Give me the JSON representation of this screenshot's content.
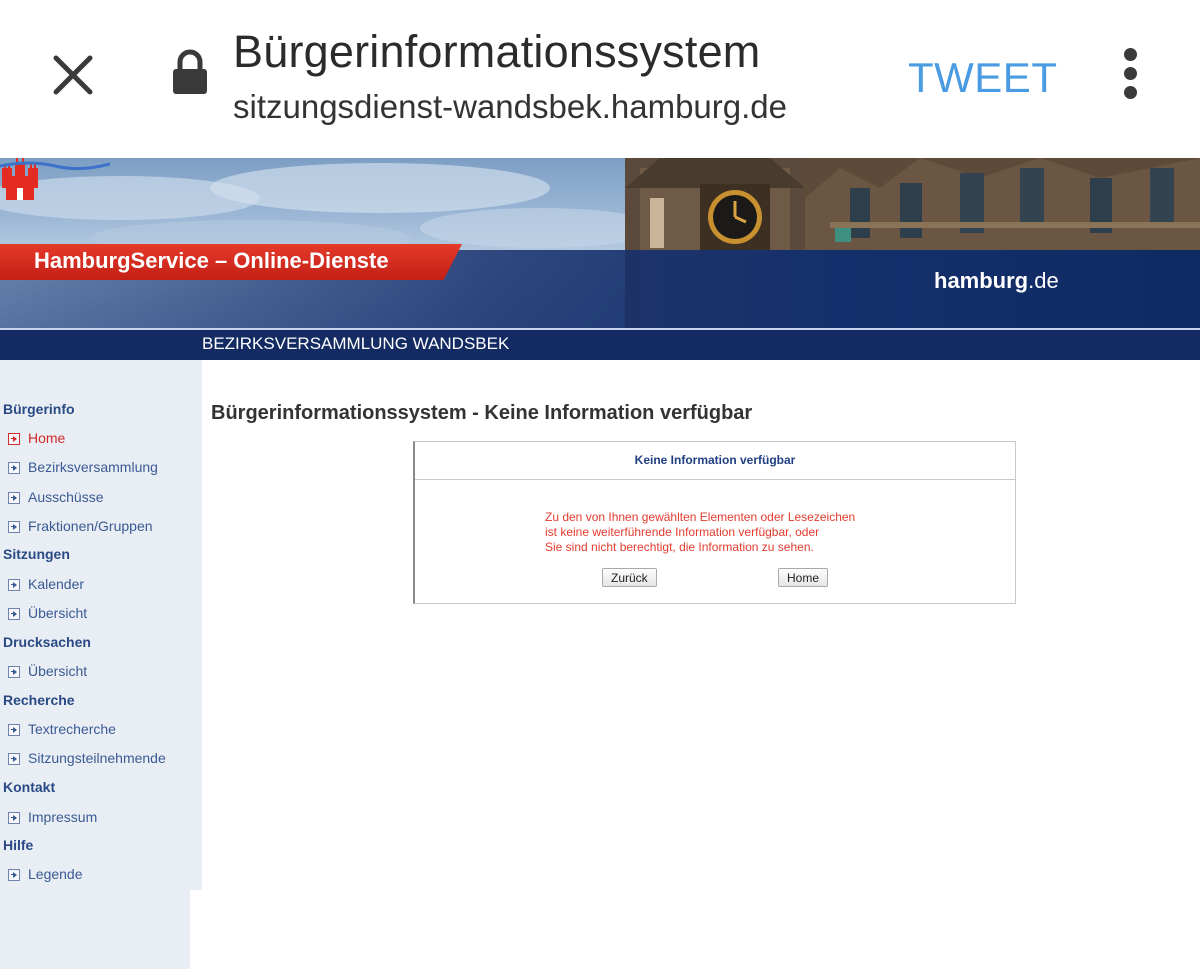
{
  "browser": {
    "title": "Bürgerinformationssystem",
    "url": "sitzungsdienst-wandsbek.hamburg.de",
    "tweet_label": "TWEET"
  },
  "banner": {
    "service_label": "HamburgService – Online-Dienste",
    "logo_main": "hamburg",
    "logo_suffix": ".de",
    "district_label": "BEZIRKSVERSAMMLUNG WANDSBEK"
  },
  "sidebar": {
    "sections": [
      {
        "title": "Bürgerinfo",
        "items": [
          "Home",
          "Bezirksversammlung",
          "Ausschüsse",
          "Fraktionen/Gruppen"
        ]
      },
      {
        "title": "Sitzungen",
        "items": [
          "Kalender",
          "Übersicht"
        ]
      },
      {
        "title": "Drucksachen",
        "items": [
          "Übersicht"
        ]
      },
      {
        "title": "Recherche",
        "items": [
          "Textrecherche",
          "Sitzungsteilnehmende"
        ]
      },
      {
        "title": "Kontakt",
        "items": [
          "Impressum"
        ]
      },
      {
        "title": "Hilfe",
        "items": [
          "Legende"
        ]
      }
    ],
    "active_item": "Home"
  },
  "main": {
    "heading": "Bürgerinformationssystem - Keine Information verfügbar",
    "box": {
      "title": "Keine Information verfügbar",
      "lines": [
        "Zu den von Ihnen gewählten Elementen oder Lesezeichen",
        "ist keine weiterführende Information verfügbar, oder",
        "Sie sind nicht berechtigt, die Information zu sehen."
      ],
      "back_label": "Zurück",
      "home_label": "Home"
    }
  },
  "colors": {
    "tweet": "#4a9be2",
    "nav_link": "#3a5a94",
    "nav_active": "#d02a2a",
    "error_text": "#e33b2e",
    "header_blue": "#132a62",
    "service_red": "#d42a1e"
  }
}
